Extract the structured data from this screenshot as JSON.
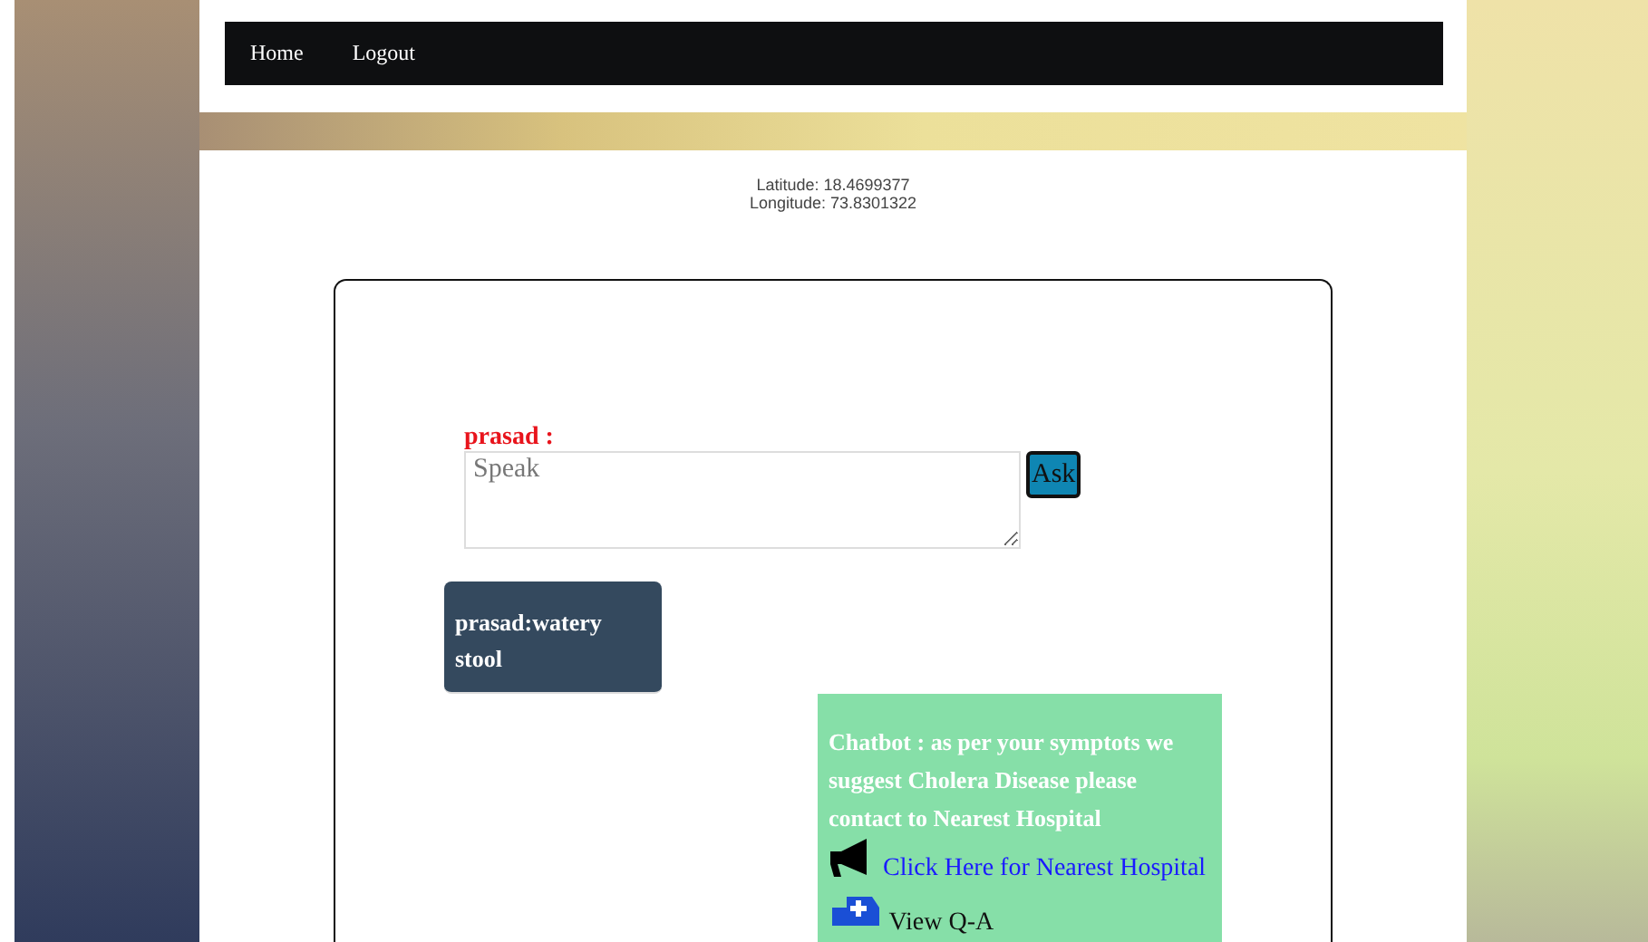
{
  "nav": [
    "Home",
    "Logout"
  ],
  "location": {
    "latitude": "Latitude: 18.4699377",
    "longitude": "Longitude: 73.8301322"
  },
  "chat": {
    "label": "prasad :",
    "placeholder": "Speak",
    "ask": "Ask",
    "user_message": "prasad:watery stool",
    "bot_message": "Chatbot : as per your symptots we suggest Cholera Disease please contact to Nearest Hospital",
    "hospital_link": "Click Here for Nearest Hospital",
    "qa_link": "View Q-A"
  }
}
